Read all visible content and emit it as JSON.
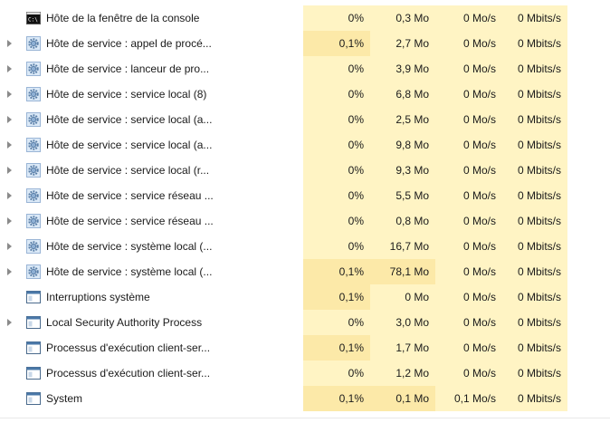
{
  "colors": {
    "heat_light": "#fff4c4",
    "heat_medium": "#fce9a8",
    "heat_strong": "#f9e08c"
  },
  "processes": [
    {
      "name": "Hôte de la fenêtre de la console",
      "icon": "console-icon",
      "expandable": false,
      "cpu": "0%",
      "memory": "0,3 Mo",
      "disk": "0 Mo/s",
      "network": "0 Mbits/s",
      "cpu_level": "light",
      "mem_level": "light"
    },
    {
      "name": "Hôte de service : appel de procé...",
      "icon": "gear-icon",
      "expandable": true,
      "cpu": "0,1%",
      "memory": "2,7 Mo",
      "disk": "0 Mo/s",
      "network": "0 Mbits/s",
      "cpu_level": "medium",
      "mem_level": "light"
    },
    {
      "name": "Hôte de service : lanceur de pro...",
      "icon": "gear-icon",
      "expandable": true,
      "cpu": "0%",
      "memory": "3,9 Mo",
      "disk": "0 Mo/s",
      "network": "0 Mbits/s",
      "cpu_level": "light",
      "mem_level": "light"
    },
    {
      "name": "Hôte de service : service local (8)",
      "icon": "gear-icon",
      "expandable": true,
      "cpu": "0%",
      "memory": "6,8 Mo",
      "disk": "0 Mo/s",
      "network": "0 Mbits/s",
      "cpu_level": "light",
      "mem_level": "light"
    },
    {
      "name": "Hôte de service : service local (a...",
      "icon": "gear-icon",
      "expandable": true,
      "cpu": "0%",
      "memory": "2,5 Mo",
      "disk": "0 Mo/s",
      "network": "0 Mbits/s",
      "cpu_level": "light",
      "mem_level": "light"
    },
    {
      "name": "Hôte de service : service local (a...",
      "icon": "gear-icon",
      "expandable": true,
      "cpu": "0%",
      "memory": "9,8 Mo",
      "disk": "0 Mo/s",
      "network": "0 Mbits/s",
      "cpu_level": "light",
      "mem_level": "light"
    },
    {
      "name": "Hôte de service : service local (r...",
      "icon": "gear-icon",
      "expandable": true,
      "cpu": "0%",
      "memory": "9,3 Mo",
      "disk": "0 Mo/s",
      "network": "0 Mbits/s",
      "cpu_level": "light",
      "mem_level": "light"
    },
    {
      "name": "Hôte de service : service réseau ...",
      "icon": "gear-icon",
      "expandable": true,
      "cpu": "0%",
      "memory": "5,5 Mo",
      "disk": "0 Mo/s",
      "network": "0 Mbits/s",
      "cpu_level": "light",
      "mem_level": "light"
    },
    {
      "name": "Hôte de service : service réseau ...",
      "icon": "gear-icon",
      "expandable": true,
      "cpu": "0%",
      "memory": "0,8 Mo",
      "disk": "0 Mo/s",
      "network": "0 Mbits/s",
      "cpu_level": "light",
      "mem_level": "light"
    },
    {
      "name": "Hôte de service : système local (...",
      "icon": "gear-icon",
      "expandable": true,
      "cpu": "0%",
      "memory": "16,7 Mo",
      "disk": "0 Mo/s",
      "network": "0 Mbits/s",
      "cpu_level": "light",
      "mem_level": "light"
    },
    {
      "name": "Hôte de service : système local (...",
      "icon": "gear-icon",
      "expandable": true,
      "cpu": "0,1%",
      "memory": "78,1 Mo",
      "disk": "0 Mo/s",
      "network": "0 Mbits/s",
      "cpu_level": "medium",
      "mem_level": "medium"
    },
    {
      "name": "Interruptions système",
      "icon": "window-icon",
      "expandable": false,
      "cpu": "0,1%",
      "memory": "0 Mo",
      "disk": "0 Mo/s",
      "network": "0 Mbits/s",
      "cpu_level": "medium",
      "mem_level": "light"
    },
    {
      "name": "Local Security Authority Process",
      "icon": "window-icon",
      "expandable": true,
      "cpu": "0%",
      "memory": "3,0 Mo",
      "disk": "0 Mo/s",
      "network": "0 Mbits/s",
      "cpu_level": "light",
      "mem_level": "light"
    },
    {
      "name": "Processus d'exécution client-ser...",
      "icon": "window-icon",
      "expandable": false,
      "cpu": "0,1%",
      "memory": "1,7 Mo",
      "disk": "0 Mo/s",
      "network": "0 Mbits/s",
      "cpu_level": "medium",
      "mem_level": "light"
    },
    {
      "name": "Processus d'exécution client-ser...",
      "icon": "window-icon",
      "expandable": false,
      "cpu": "0%",
      "memory": "1,2 Mo",
      "disk": "0 Mo/s",
      "network": "0 Mbits/s",
      "cpu_level": "light",
      "mem_level": "light"
    },
    {
      "name": "System",
      "icon": "window-icon",
      "expandable": false,
      "cpu": "0,1%",
      "memory": "0,1 Mo",
      "disk": "0,1 Mo/s",
      "network": "0 Mbits/s",
      "cpu_level": "medium",
      "mem_level": "medium"
    }
  ]
}
